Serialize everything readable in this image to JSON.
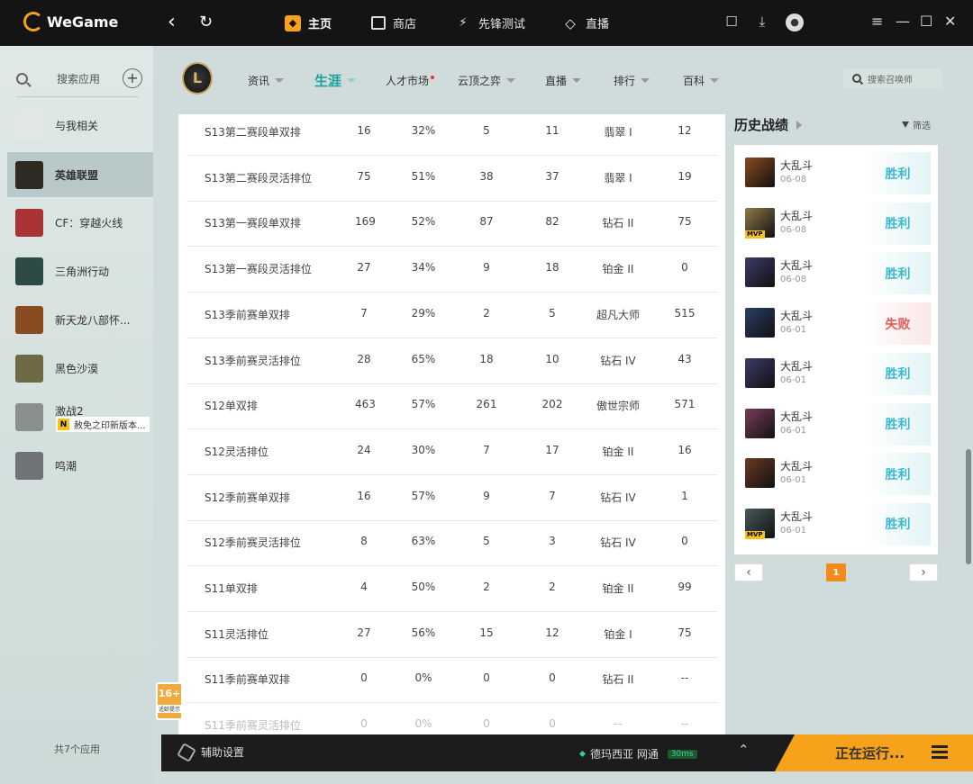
{
  "app": {
    "brand": "WeGame"
  },
  "topnav": {
    "tabs": [
      {
        "label": "主页",
        "icon": "home-icon",
        "active": true
      },
      {
        "label": "商店",
        "icon": "store-icon",
        "active": false
      },
      {
        "label": "先锋测试",
        "icon": "vanguard-icon",
        "active": false
      },
      {
        "label": "直播",
        "icon": "live-icon",
        "active": false
      }
    ]
  },
  "sidebar": {
    "search_placeholder": "搜索应用",
    "items": [
      {
        "label": "与我相关",
        "icon": "related-icon",
        "color": "#e2e8e6"
      },
      {
        "label": "英雄联盟",
        "icon": "lol-icon",
        "color": "#2d2a22"
      },
      {
        "label": "CF：穿越火线",
        "icon": "cf-icon",
        "color": "#a33"
      },
      {
        "label": "三角洲行动",
        "icon": "delta-icon",
        "color": "#2e4a44"
      },
      {
        "label": "新天龙八部怀...",
        "icon": "tlbb-icon",
        "color": "#8a4b20"
      },
      {
        "label": "黑色沙漠",
        "icon": "black-desert-icon",
        "color": "#6f6a45"
      },
      {
        "label": "激战2",
        "icon": "gw2-icon",
        "color": "#8a8f8f"
      },
      {
        "label": "鸣潮",
        "icon": "wuthering-icon",
        "color": "#6e7477"
      }
    ],
    "sub_notice": "赦免之印新版本...",
    "sub_notice_badge": "N",
    "count": "共7个应用"
  },
  "subnav": {
    "logo_text": "L",
    "tabs": [
      {
        "label": "资讯",
        "active": false,
        "caret": true,
        "dot": false
      },
      {
        "label": "生涯",
        "active": true,
        "caret": true,
        "dot": false
      },
      {
        "label": "人才市场",
        "active": false,
        "caret": false,
        "dot": true
      },
      {
        "label": "云顶之弈",
        "active": false,
        "caret": true,
        "dot": false
      },
      {
        "label": "直播",
        "active": false,
        "caret": true,
        "dot": false
      },
      {
        "label": "排行",
        "active": false,
        "caret": true,
        "dot": false
      },
      {
        "label": "百科",
        "active": false,
        "caret": true,
        "dot": false
      }
    ],
    "summoner_search_placeholder": "搜索召唤师"
  },
  "rank_table": {
    "rows": [
      [
        "S13第二赛段单双排",
        "16",
        "32%",
        "5",
        "11",
        "翡翠 I",
        "12"
      ],
      [
        "S13第二赛段灵活排位",
        "75",
        "51%",
        "38",
        "37",
        "翡翠 I",
        "19"
      ],
      [
        "S13第一赛段单双排",
        "169",
        "52%",
        "87",
        "82",
        "钻石 II",
        "75"
      ],
      [
        "S13第一赛段灵活排位",
        "27",
        "34%",
        "9",
        "18",
        "铂金 II",
        "0"
      ],
      [
        "S13季前赛单双排",
        "7",
        "29%",
        "2",
        "5",
        "超凡大师",
        "515"
      ],
      [
        "S13季前赛灵活排位",
        "28",
        "65%",
        "18",
        "10",
        "钻石 IV",
        "43"
      ],
      [
        "S12单双排",
        "463",
        "57%",
        "261",
        "202",
        "傲世宗师",
        "571"
      ],
      [
        "S12灵活排位",
        "24",
        "30%",
        "7",
        "17",
        "铂金 II",
        "16"
      ],
      [
        "S12季前赛单双排",
        "16",
        "57%",
        "9",
        "7",
        "钻石 IV",
        "1"
      ],
      [
        "S12季前赛灵活排位",
        "8",
        "63%",
        "5",
        "3",
        "钻石 IV",
        "0"
      ],
      [
        "S11单双排",
        "4",
        "50%",
        "2",
        "2",
        "铂金 II",
        "99"
      ],
      [
        "S11灵活排位",
        "27",
        "56%",
        "15",
        "12",
        "铂金 I",
        "75"
      ],
      [
        "S11季前赛单双排",
        "0",
        "0%",
        "0",
        "0",
        "钻石 II",
        "--"
      ],
      [
        "S11季前赛灵活排位",
        "0",
        "0%",
        "0",
        "0",
        "--",
        "--"
      ]
    ]
  },
  "age_badge": {
    "rating": "16+",
    "note": "适龄提示"
  },
  "history": {
    "title": "历史战绩",
    "filter_label": "筛选",
    "matches": [
      {
        "mode": "大乱斗",
        "date": "06-08",
        "result": "胜利",
        "win": true,
        "mvp": false,
        "color": "#8b4a1e"
      },
      {
        "mode": "大乱斗",
        "date": "06-08",
        "result": "胜利",
        "win": true,
        "mvp": true,
        "color": "#8f7a48"
      },
      {
        "mode": "大乱斗",
        "date": "06-08",
        "result": "胜利",
        "win": true,
        "mvp": false,
        "color": "#3e3a6a"
      },
      {
        "mode": "大乱斗",
        "date": "06-01",
        "result": "失败",
        "win": false,
        "mvp": false,
        "color": "#2b3f66"
      },
      {
        "mode": "大乱斗",
        "date": "06-01",
        "result": "胜利",
        "win": true,
        "mvp": false,
        "color": "#3e3a6a"
      },
      {
        "mode": "大乱斗",
        "date": "06-01",
        "result": "胜利",
        "win": true,
        "mvp": false,
        "color": "#7a3c5a"
      },
      {
        "mode": "大乱斗",
        "date": "06-01",
        "result": "胜利",
        "win": true,
        "mvp": false,
        "color": "#6b3a22"
      },
      {
        "mode": "大乱斗",
        "date": "06-01",
        "result": "胜利",
        "win": true,
        "mvp": true,
        "color": "#4a5a5a"
      }
    ],
    "prev_label": "‹",
    "next_label": "›",
    "current_page": "1"
  },
  "bottombar": {
    "assist_label": "辅助设置",
    "server": "德玛西亚 网通",
    "ping": "30ms",
    "running_label": "正在运行..."
  }
}
